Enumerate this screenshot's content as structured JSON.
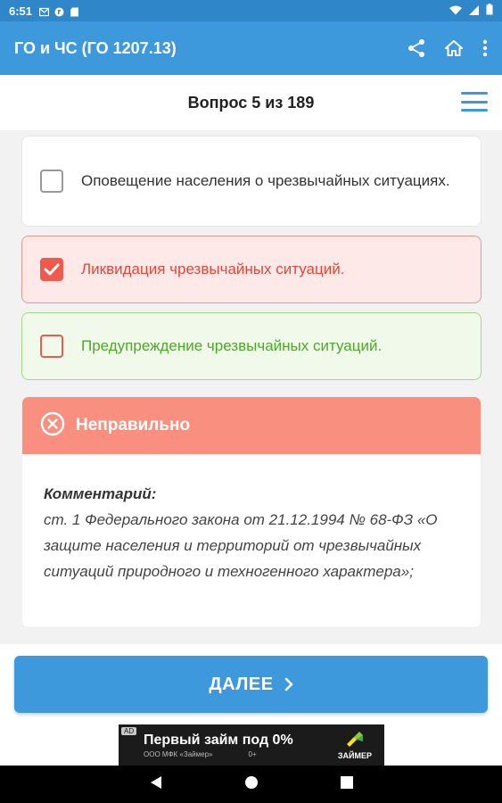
{
  "status": {
    "time": "6:51"
  },
  "app": {
    "title": "ГО и ЧС (ГО 1207.13)"
  },
  "question": {
    "counter": "Вопрос 5 из 189"
  },
  "answers": [
    {
      "text": "Оповещение населения о чрезвычайных ситуациях.",
      "state": "neutral",
      "checked": false
    },
    {
      "text": "Ликвидация чрезвычайных ситуаций.",
      "state": "wrong",
      "checked": true
    },
    {
      "text": "Предупреждение чрезвычайных ситуаций.",
      "state": "correct",
      "checked": false
    }
  ],
  "result": {
    "title": "Неправильно",
    "comment_label": "Комментарий:",
    "comment_text": "ст. 1 Федерального закона от 21.12.1994 № 68-ФЗ «О защите населения и территорий от чрезвычайных ситуаций природного и техногенного характера»;"
  },
  "next_button": {
    "label": "ДАЛЕЕ"
  },
  "ad": {
    "tag": "AD",
    "title": "Первый займ под 0%",
    "subtitle": "ООО МФК «Займер»",
    "age": "0+",
    "brand": "ЗАЙМЕР"
  },
  "colors": {
    "primary": "#3e98dc",
    "wrong": "#ee5b4e",
    "correct": "#4ea82a",
    "result_header": "#f9907f"
  }
}
